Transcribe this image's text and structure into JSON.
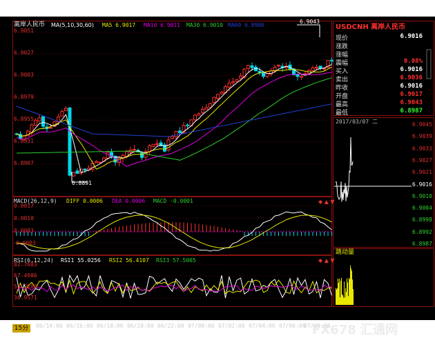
{
  "main_panel": {
    "title": "离岸人民币",
    "ma_params": "MA(5,10,30,60)",
    "ma5": "MA5 6.9017",
    "ma10": "MA10 6.9011",
    "ma30": "MA30 6.9010",
    "ma60": "MA60 6.8986",
    "y_ticks": [
      "6.9051",
      "6.9027",
      "6.9003",
      "6.8979",
      "6.8955",
      "6.8931",
      "6.8907"
    ],
    "high_annotation": "6.9043",
    "low_annotation": "6.8891"
  },
  "macd_panel": {
    "params": "MACD(26,12,9)",
    "diff": "DIFF 0.0006",
    "dea": "DEA 0.0006",
    "macd": "MACD -0.0001",
    "y_ticks": [
      "0.0017",
      "0.0010",
      "0.0003",
      "-0.0003"
    ]
  },
  "rsi_panel": {
    "params": "RSI(6,12,24)",
    "rsi1": "RSI1 55.0256",
    "rsi2": "RSI2 56.4107",
    "rsi3": "RSI3 57.5005",
    "y_ticks": [
      "82.7683",
      "67.4986",
      "52.2289",
      "36.9571"
    ]
  },
  "time_axis": [
    "06/14:00",
    "06/16:00",
    "06/18:00",
    "06/20:00",
    "06/22:00",
    "07/00:00",
    "07/02:00",
    "07/04:00",
    "07/06:00",
    "07/08:00"
  ],
  "interval": "15分",
  "quote": {
    "title": "USDCNH 离岸人民币",
    "rows": [
      {
        "k": "现价",
        "v": "6.9016",
        "color": "#ffffff"
      },
      {
        "k": "涨跌",
        "v": "",
        "color": "#ffffff"
      },
      {
        "k": "涨幅",
        "v": "",
        "color": "#ffffff"
      },
      {
        "k": "震幅",
        "v": "0.08%",
        "color": "#ff3030"
      },
      {
        "k": "买入",
        "v": "6.9016",
        "color": "#ffffff"
      },
      {
        "k": "卖出",
        "v": "6.9036",
        "color": "#ff3030"
      },
      {
        "k": "昨收",
        "v": "6.9016",
        "color": "#ffffff"
      },
      {
        "k": "开盘",
        "v": "6.9017",
        "color": "#ff3030"
      },
      {
        "k": "最高",
        "v": "6.9043",
        "color": "#ff3030"
      },
      {
        "k": "最低",
        "v": "6.8987",
        "color": "#30ff30"
      }
    ]
  },
  "intraday": {
    "date": "2017/03/07 二",
    "y_ticks": [
      "6.9045",
      "6.9039",
      "6.9033",
      "6.9027",
      "6.9021",
      "6.9016",
      "6.9010",
      "6.9004",
      "6.8998",
      "6.8992",
      "6.8987"
    ],
    "volume_label": "跳动量"
  },
  "watermark": "FX678 汇通网",
  "colors": {
    "up": "#ff3030",
    "down": "#00d8e8",
    "ma5": "#ffffff",
    "ma10": "#e8e800",
    "ma30": "#e000e0",
    "ma60": "#30d030",
    "grid": "#8b0000"
  }
}
